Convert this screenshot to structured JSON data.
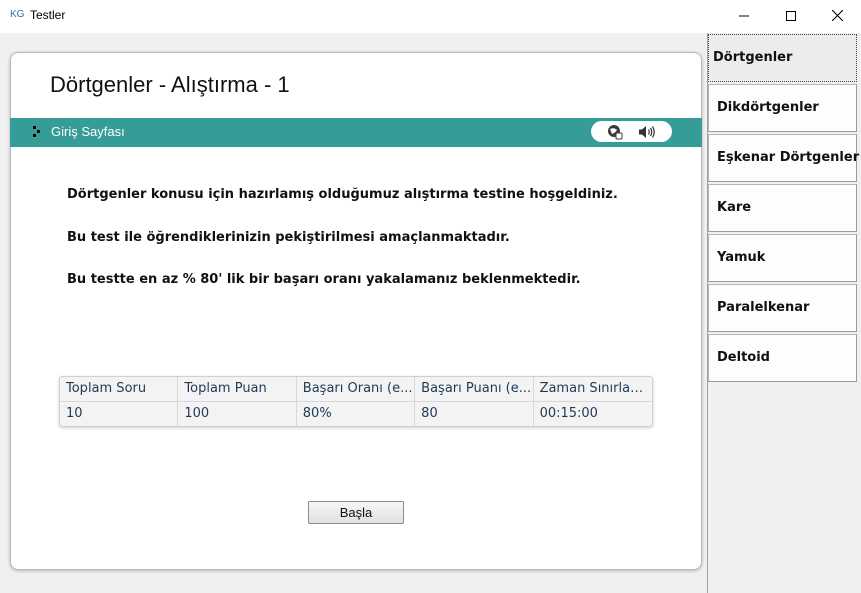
{
  "window": {
    "app_icon_text": "KG",
    "title": "Testler"
  },
  "page": {
    "title": "Dörtgenler - Alıştırma - 1",
    "breadcrumb": "Giriş Sayfası",
    "paragraphs": [
      "Dörtgenler konusu için hazırlamış olduğumuz alıştırma testine hoşgeldiniz.",
      "Bu test ile öğrendiklerinizin pekiştirilmesi amaçlanmaktadır.",
      "Bu testte en az % 80' lik bir başarı oranı yakalamanız beklenmektedir."
    ],
    "start_button": "Başla"
  },
  "table": {
    "headers": [
      "Toplam Soru",
      "Toplam Puan",
      "Başarı Oranı (e...",
      "Başarı Puanı (e...",
      "Zaman Sınırlam..."
    ],
    "row": [
      "10",
      "100",
      "80%",
      "80",
      "00:15:00"
    ]
  },
  "sidebar": {
    "items": [
      {
        "label": "Dörtgenler",
        "active": true
      },
      {
        "label": "Dikdörtgenler"
      },
      {
        "label": "Eşkenar Dörtgenler"
      },
      {
        "label": "Kare"
      },
      {
        "label": "Yamuk"
      },
      {
        "label": "Paralelkenar"
      },
      {
        "label": "Deltoid"
      }
    ]
  },
  "icons": {
    "minimize": "minimize-icon",
    "maximize": "maximize-icon",
    "close": "close-icon",
    "breadcrumb": "breadcrumb-arrow-icon",
    "globe": "globe-icon",
    "speaker": "speaker-icon"
  },
  "colors": {
    "accent_bar": "#359c97",
    "table_text": "#1e3a56"
  }
}
